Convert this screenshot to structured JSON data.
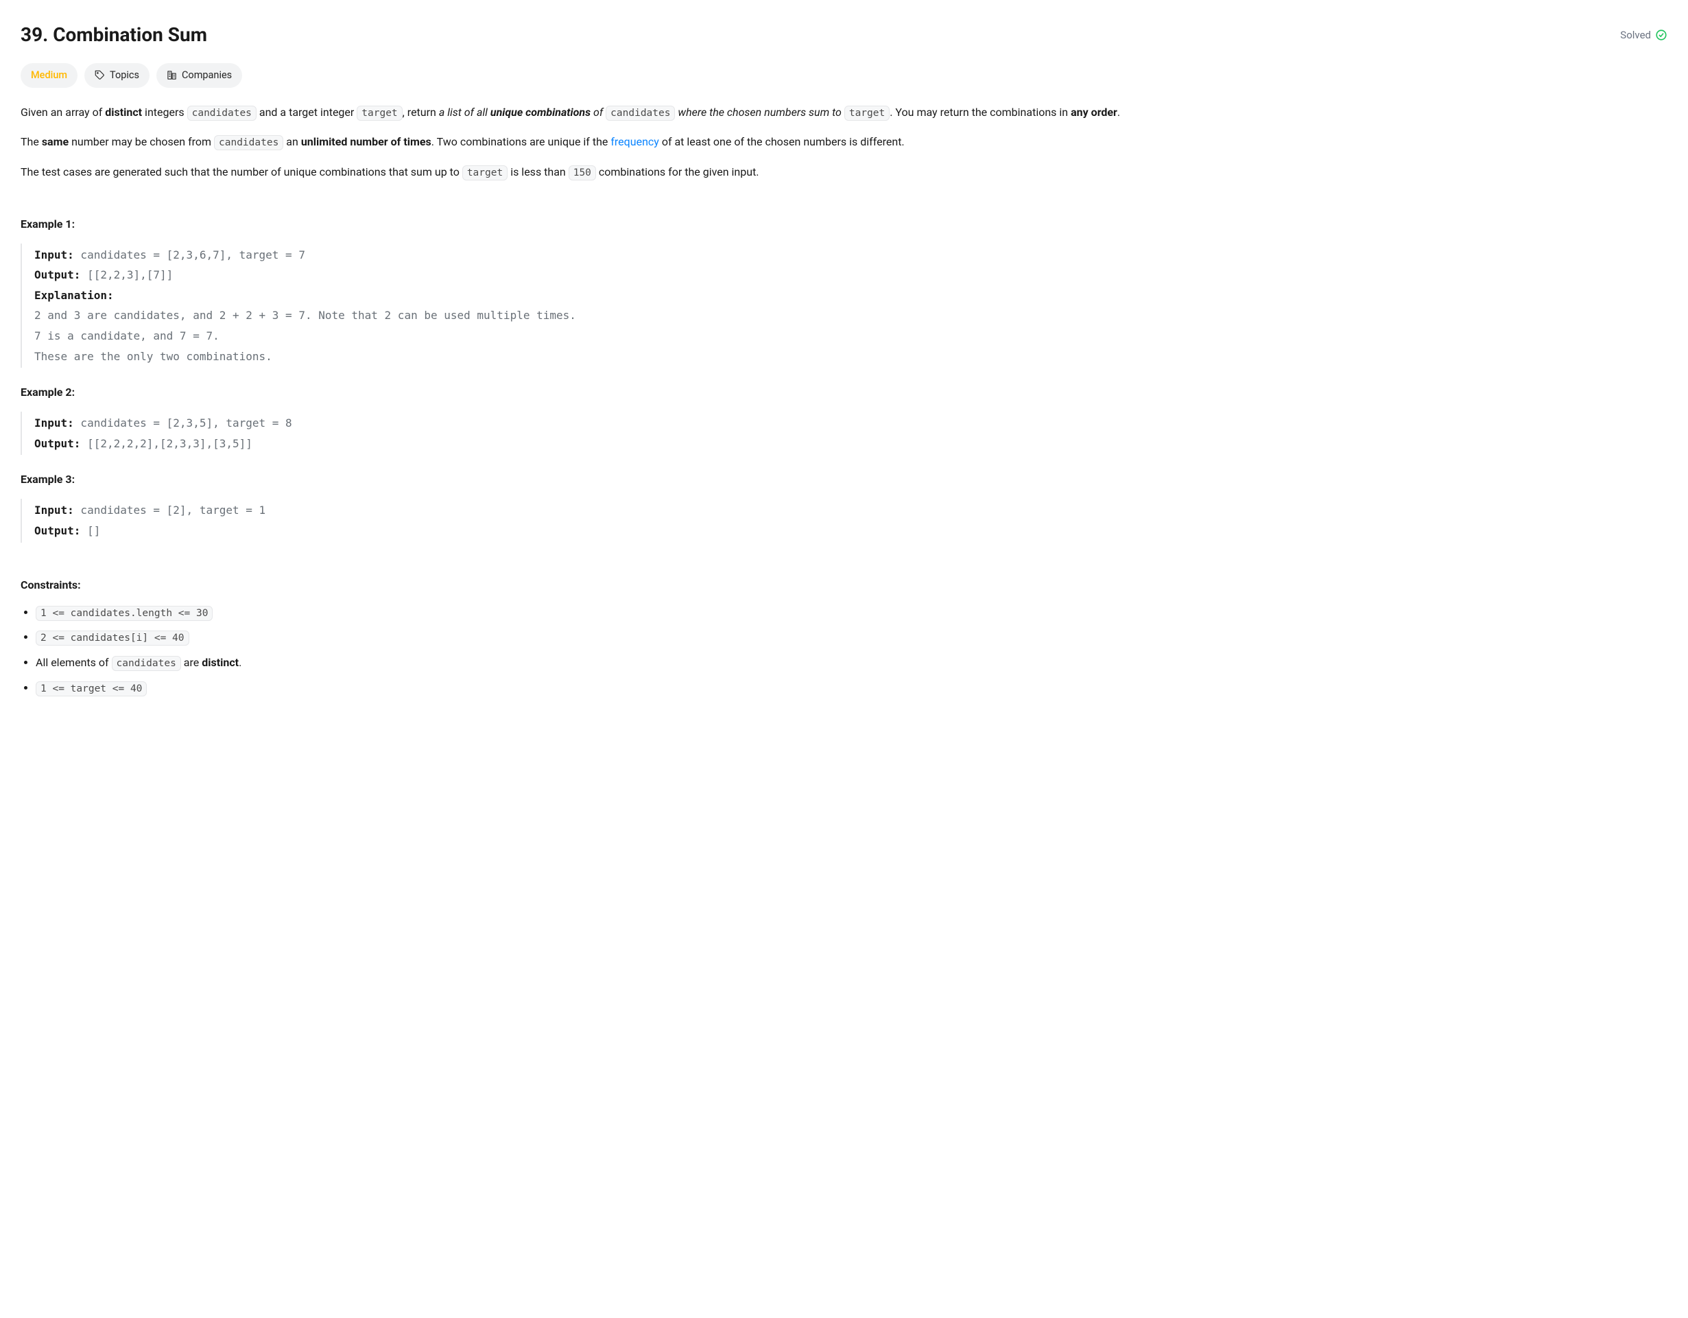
{
  "header": {
    "title": "39. Combination Sum",
    "solved_label": "Solved"
  },
  "pills": {
    "difficulty": "Medium",
    "topics": "Topics",
    "companies": "Companies"
  },
  "description": {
    "p1_seg1": "Given an array of ",
    "p1_bold1": "distinct",
    "p1_seg2": " integers ",
    "p1_code1": "candidates",
    "p1_seg3": " and a target integer ",
    "p1_code2": "target",
    "p1_seg4": ", return ",
    "p1_ital1": "a list of all ",
    "p1_bolditalic1": "unique combinations",
    "p1_ital2": " of ",
    "p1_code3": "candidates",
    "p1_ital3": " where the chosen numbers sum to ",
    "p1_code4": "target",
    "p1_seg5": ". You may return the combinations in ",
    "p1_bold2": "any order",
    "p1_seg6": ".",
    "p2_seg1": "The ",
    "p2_bold1": "same",
    "p2_seg2": " number may be chosen from ",
    "p2_code1": "candidates",
    "p2_seg3": " an ",
    "p2_bold2": "unlimited number of times",
    "p2_seg4": ". Two combinations are unique if the ",
    "p2_link1": "frequency",
    "p2_seg5": " of at least one of the chosen numbers is different.",
    "p3_seg1": "The test cases are generated such that the number of unique combinations that sum up to ",
    "p3_code1": "target",
    "p3_seg2": " is less than ",
    "p3_code2": "150",
    "p3_seg3": " combinations for the given input."
  },
  "examples": {
    "ex1_label": "Example 1:",
    "ex1_input_label": "Input:",
    "ex1_input": " candidates = [2,3,6,7], target = 7",
    "ex1_output_label": "Output:",
    "ex1_output": " [[2,2,3],[7]]",
    "ex1_explanation_label": "Explanation:",
    "ex1_explanation": "\n2 and 3 are candidates, and 2 + 2 + 3 = 7. Note that 2 can be used multiple times.\n7 is a candidate, and 7 = 7.\nThese are the only two combinations.",
    "ex2_label": "Example 2:",
    "ex2_input_label": "Input:",
    "ex2_input": " candidates = [2,3,5], target = 8",
    "ex2_output_label": "Output:",
    "ex2_output": " [[2,2,2,2],[2,3,3],[3,5]]",
    "ex3_label": "Example 3:",
    "ex3_input_label": "Input:",
    "ex3_input": " candidates = [2], target = 1",
    "ex3_output_label": "Output:",
    "ex3_output": " []"
  },
  "constraints": {
    "label": "Constraints:",
    "c1": "1 <= candidates.length <= 30",
    "c2": "2 <= candidates[i] <= 40",
    "c3_seg1": "All elements of ",
    "c3_code": "candidates",
    "c3_seg2": " are ",
    "c3_bold": "distinct",
    "c3_seg3": ".",
    "c4": "1 <= target <= 40"
  }
}
